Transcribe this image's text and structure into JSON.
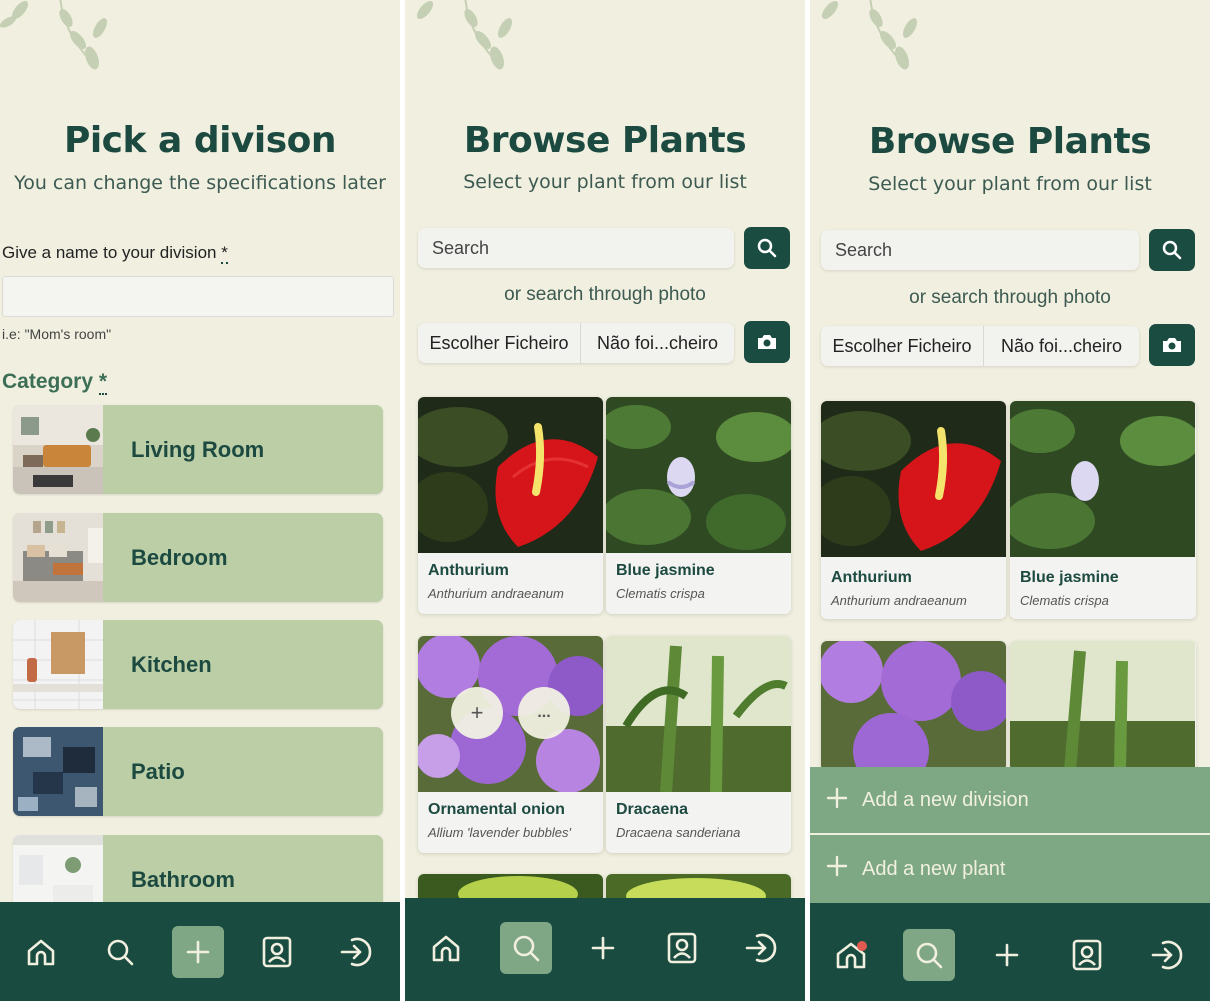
{
  "screen1": {
    "title": "Pick a divison",
    "subtitle": "You can change the specifications later",
    "name_label": "Give a name to your division",
    "required_mark": "*",
    "name_value": "",
    "name_hint": "i.e: \"Mom's room\"",
    "category_label": "Category",
    "categories": [
      {
        "label": "Living Room",
        "icon": "living-room-photo"
      },
      {
        "label": "Bedroom",
        "icon": "bedroom-photo"
      },
      {
        "label": "Kitchen",
        "icon": "kitchen-photo"
      },
      {
        "label": "Patio",
        "icon": "patio-photo"
      },
      {
        "label": "Bathroom",
        "icon": "bathroom-photo"
      }
    ],
    "active_nav": "add"
  },
  "browse": {
    "title": "Browse Plants",
    "subtitle": "Select your plant from our list",
    "search_placeholder": "Search",
    "photo_text": "or search through photo",
    "file_button": "Escolher Ficheiro",
    "file_status": "Não foi...cheiro",
    "plants": [
      {
        "name": "Anthurium",
        "scientific": "Anthurium andraeanum"
      },
      {
        "name": "Blue jasmine",
        "scientific": "Clematis crispa"
      },
      {
        "name": "Ornamental onion",
        "scientific": "Allium 'lavender bubbles'"
      },
      {
        "name": "Dracaena",
        "scientific": "Dracaena sanderiana"
      }
    ],
    "card_actions": [
      "+",
      "..."
    ]
  },
  "screen3": {
    "menu": [
      {
        "label": "Add a new division",
        "icon": "plus-icon"
      },
      {
        "label": "Add a new plant",
        "icon": "plus-icon"
      }
    ]
  },
  "nav": [
    "home-icon",
    "search-icon",
    "plus-icon",
    "profile-icon",
    "logout-icon"
  ],
  "colors": {
    "background": "#f1f0e0",
    "primary": "#194b40",
    "accent": "#7fa785",
    "card": "#bccea6",
    "notification": "#e05a4f"
  }
}
